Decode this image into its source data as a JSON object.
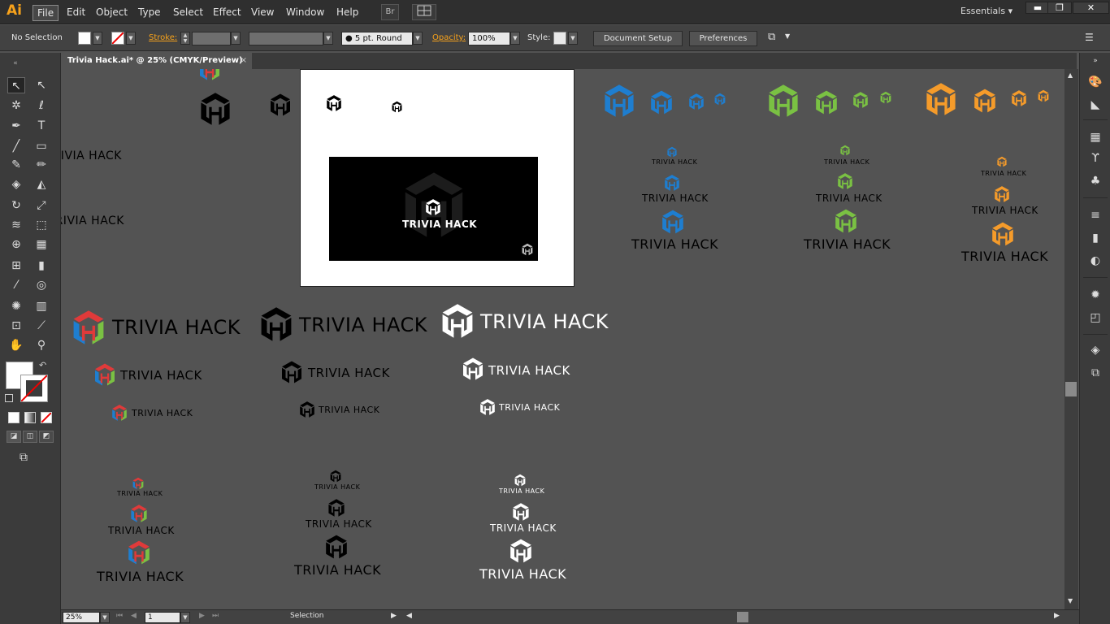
{
  "app": {
    "logo": "Ai"
  },
  "menu": [
    "File",
    "Edit",
    "Object",
    "Type",
    "Select",
    "Effect",
    "View",
    "Window",
    "Help"
  ],
  "bridge_label": "Br",
  "workspace": "Essentials",
  "control": {
    "selection": "No Selection",
    "stroke_label": "Stroke:",
    "brush": "5 pt. Round",
    "opacity_label": "Opacity:",
    "opacity_value": "100%",
    "style_label": "Style:",
    "document_setup": "Document Setup",
    "preferences": "Preferences"
  },
  "document_tab": {
    "title": "Trivia Hack.ai* @ 25% (CMYK/Preview)",
    "close": "×"
  },
  "status": {
    "zoom": "25%",
    "artboard": "1",
    "mode": "Selection"
  },
  "artwork": {
    "wordmark": "TRIVIA HACK",
    "mark_letters": "H",
    "colors": {
      "red": "#e03a3a",
      "blue": "#1e7ed0",
      "green": "#7ac143",
      "orange": "#f59b2a",
      "black": "#000000",
      "white": "#ffffff"
    }
  }
}
